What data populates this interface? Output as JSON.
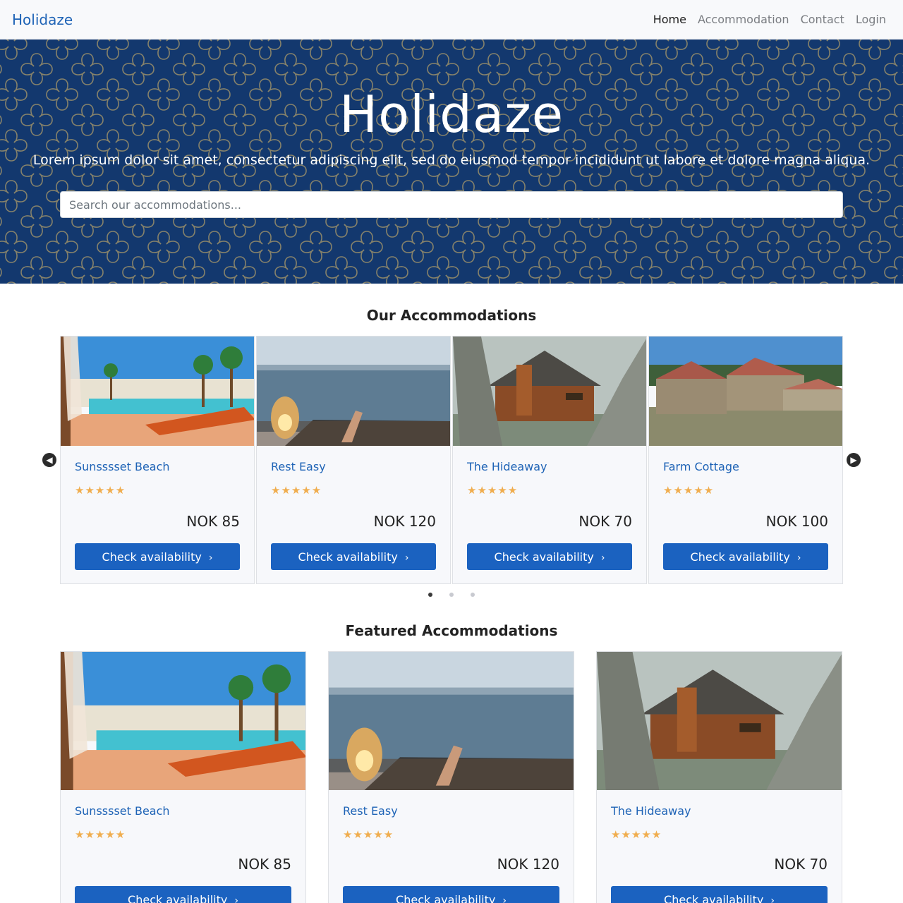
{
  "navbar": {
    "brand": "Holidaze",
    "links": [
      "Home",
      "Accommodation",
      "Contact",
      "Login"
    ]
  },
  "hero": {
    "title": "Holidaze",
    "subtitle": "Lorem ipsum dolor sit amet, consectetur adipiscing elit, sed do eiusmod tempor incididunt ut labore et dolore magna aliqua.",
    "search_placeholder": "Search our accommodations..."
  },
  "carousel": {
    "title": "Our Accommodations",
    "cards": [
      {
        "name": "Sunsssset Beach",
        "rating": 5,
        "price": "NOK 85",
        "button": "Check availability",
        "image": "beach-resort-image"
      },
      {
        "name": "Rest Easy",
        "rating": 5,
        "price": "NOK 120",
        "button": "Check availability",
        "image": "lake-relax-image"
      },
      {
        "name": "The Hideaway",
        "rating": 5,
        "price": "NOK 70",
        "button": "Check availability",
        "image": "wooden-cabin-image"
      },
      {
        "name": "Farm Cottage",
        "rating": 5,
        "price": "NOK 100",
        "button": "Check availability",
        "image": "farm-cottage-image"
      }
    ],
    "pages": 3,
    "active_page": 1
  },
  "featured": {
    "title": "Featured Accommodations",
    "cards": [
      {
        "name": "Sunsssset Beach",
        "rating": 5,
        "price": "NOK 85",
        "button": "Check availability",
        "image": "beach-resort-image"
      },
      {
        "name": "Rest Easy",
        "rating": 5,
        "price": "NOK 120",
        "button": "Check availability",
        "image": "lake-relax-image"
      },
      {
        "name": "The Hideaway",
        "rating": 5,
        "price": "NOK 70",
        "button": "Check availability",
        "image": "wooden-cabin-image"
      }
    ]
  },
  "colors": {
    "brand": "#1e63b6",
    "hero_bg": "#13386e",
    "pattern": "#9a8f6a",
    "button": "#1b62c0",
    "star": "#f0ad4e"
  }
}
